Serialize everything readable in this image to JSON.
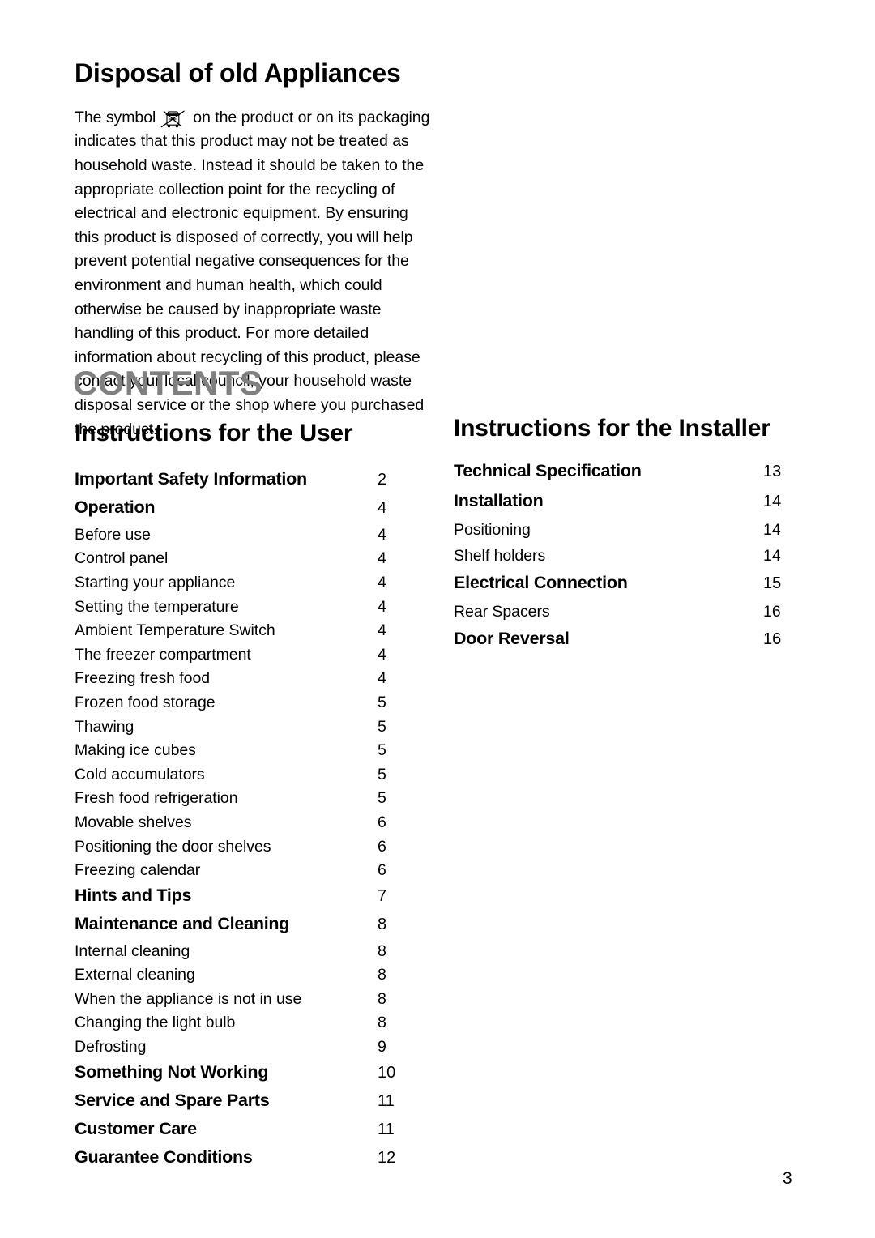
{
  "disposal": {
    "title": "Disposal of old Appliances",
    "icon": "crossed-out-wheelie-bin-icon",
    "body_before_icon": "The symbol",
    "body_after_icon": "on the product or on its packaging indicates that this product may not be treated as household waste. Instead it should be taken to the appropriate collection point for the recycling of electrical and electronic equipment. By ensuring this product is disposed of correctly, you will help prevent potential negative consequences for the environment and human health, which could otherwise be caused by inappropriate waste handling of this product. For more detailed information about recycling of this product, please contact your local council, your household waste disposal service or the shop where you purchased the product."
  },
  "contents": {
    "title": "CONTENTS",
    "title_color": "#808080",
    "columns": [
      {
        "heading": "Instructions for the User",
        "entries": [
          {
            "label": "Important Safety Information",
            "page": "2",
            "level": "major"
          },
          {
            "label": "Operation",
            "page": "4",
            "level": "major"
          },
          {
            "label": "Before use",
            "page": "4",
            "level": "minor"
          },
          {
            "label": "Control panel",
            "page": "4",
            "level": "minor"
          },
          {
            "label": "Starting your appliance",
            "page": "4",
            "level": "minor"
          },
          {
            "label": "Setting the temperature",
            "page": "4",
            "level": "minor"
          },
          {
            "label": "Ambient Temperature Switch",
            "page": "4",
            "level": "minor"
          },
          {
            "label": "The freezer compartment",
            "page": "4",
            "level": "minor"
          },
          {
            "label": "Freezing fresh food",
            "page": "4",
            "level": "minor"
          },
          {
            "label": "Frozen food storage",
            "page": "5",
            "level": "minor"
          },
          {
            "label": "Thawing",
            "page": "5",
            "level": "minor"
          },
          {
            "label": "Making ice cubes",
            "page": "5",
            "level": "minor"
          },
          {
            "label": "Cold accumulators",
            "page": "5",
            "level": "minor"
          },
          {
            "label": "Fresh food refrigeration",
            "page": "5",
            "level": "minor"
          },
          {
            "label": "Movable shelves",
            "page": "6",
            "level": "minor"
          },
          {
            "label": "Positioning the door shelves",
            "page": "6",
            "level": "minor"
          },
          {
            "label": "Freezing calendar",
            "page": "6",
            "level": "minor"
          },
          {
            "label": "Hints and Tips",
            "page": "7",
            "level": "major"
          },
          {
            "label": "Maintenance and Cleaning",
            "page": "8",
            "level": "major"
          },
          {
            "label": "Internal cleaning",
            "page": "8",
            "level": "minor"
          },
          {
            "label": "External cleaning",
            "page": "8",
            "level": "minor"
          },
          {
            "label": "When the appliance is not in use",
            "page": "8",
            "level": "minor"
          },
          {
            "label": "Changing the light bulb",
            "page": "8",
            "level": "minor"
          },
          {
            "label": "Defrosting",
            "page": "9",
            "level": "minor"
          },
          {
            "label": "Something Not Working",
            "page": "10",
            "level": "major"
          },
          {
            "label": "Service and Spare Parts",
            "page": "11",
            "level": "major"
          },
          {
            "label": "Customer Care",
            "page": "11",
            "level": "major"
          },
          {
            "label": "Guarantee Conditions",
            "page": "12",
            "level": "major"
          }
        ]
      },
      {
        "heading": "Instructions for the Installer",
        "entries": [
          {
            "label": "Technical Specification",
            "page": "13",
            "level": "major"
          },
          {
            "label": "Installation",
            "page": "14",
            "level": "major"
          },
          {
            "label": "Positioning",
            "page": "14",
            "level": "minor"
          },
          {
            "label": "Shelf holders",
            "page": "14",
            "level": "minor"
          },
          {
            "label": "Electrical Connection",
            "page": "15",
            "level": "major"
          },
          {
            "label": "Rear Spacers",
            "page": "16",
            "level": "minor"
          },
          {
            "label": "Door Reversal",
            "page": "16",
            "level": "major"
          }
        ]
      }
    ]
  },
  "footer": {
    "page_number": "3"
  }
}
